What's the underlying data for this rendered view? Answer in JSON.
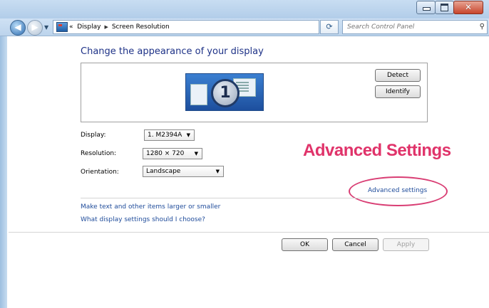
{
  "address_bar": {
    "breadcrumbs": [
      "Display",
      "Screen Resolution"
    ],
    "search_placeholder": "Search Control Panel"
  },
  "window_controls": [
    "minimize",
    "maximize",
    "close"
  ],
  "main": {
    "heading": "Change the appearance of your display",
    "monitor_number": "1",
    "detect_label": "Detect",
    "identify_label": "Identify",
    "display_label": "Display:",
    "display_value": "1. M2394A",
    "resolution_label": "Resolution:",
    "resolution_value": "1280 × 720",
    "orientation_label": "Orientation:",
    "orientation_value": "Landscape",
    "advanced_link": "Advanced settings",
    "link_text_size": "Make text and other items larger or smaller",
    "link_help": "What display settings should I choose?",
    "ok_label": "OK",
    "cancel_label": "Cancel",
    "apply_label": "Apply"
  },
  "annotation": {
    "text": "Advanced Settings",
    "color": "#e0336a"
  }
}
